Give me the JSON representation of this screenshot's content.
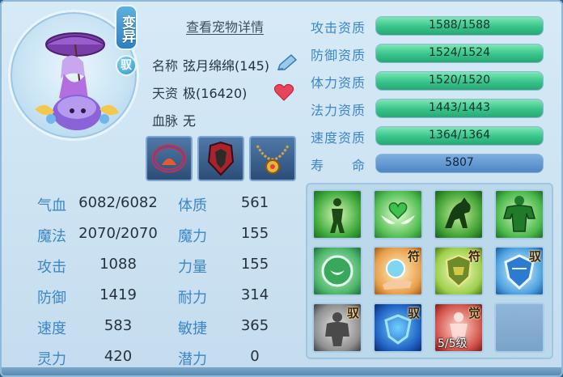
{
  "header": {
    "mutation_badge": "变异",
    "ride_badge": "驭",
    "detail_link": "查看宠物详情"
  },
  "pet": {
    "name_label": "名称",
    "name_value": "弦月绵绵(145)",
    "talent_label": "天资",
    "talent_value": "极(16420)",
    "bloodline_label": "血脉",
    "bloodline_value": "无"
  },
  "stats": [
    {
      "label": "气血",
      "value": "6082/6082"
    },
    {
      "label": "体质",
      "value": "561"
    },
    {
      "label": "魔法",
      "value": "2070/2070"
    },
    {
      "label": "魔力",
      "value": "155"
    },
    {
      "label": "攻击",
      "value": "1088"
    },
    {
      "label": "力量",
      "value": "155"
    },
    {
      "label": "防御",
      "value": "1419"
    },
    {
      "label": "耐力",
      "value": "314"
    },
    {
      "label": "速度",
      "value": "583"
    },
    {
      "label": "敏捷",
      "value": "365"
    },
    {
      "label": "灵力",
      "value": "420"
    },
    {
      "label": "潜力",
      "value": "0"
    }
  ],
  "aptitudes": [
    {
      "label": "攻击资质",
      "value": "1588/1588",
      "fill": 1.0
    },
    {
      "label": "防御资质",
      "value": "1524/1524",
      "fill": 1.0
    },
    {
      "label": "体力资质",
      "value": "1520/1520",
      "fill": 1.0
    },
    {
      "label": "法力资质",
      "value": "1443/1443",
      "fill": 1.0
    },
    {
      "label": "速度资质",
      "value": "1364/1364",
      "fill": 1.0
    }
  ],
  "lifespan": {
    "label": "寿　　命",
    "value": "5807"
  },
  "equipment": [
    "ring-equipment-icon",
    "armor-equipment-icon",
    "necklace-equipment-icon"
  ],
  "skills": [
    {
      "icon": "figure-aura-icon",
      "tag": "",
      "level": ""
    },
    {
      "icon": "winged-heart-icon",
      "tag": "",
      "level": ""
    },
    {
      "icon": "horse-icon",
      "tag": "",
      "level": ""
    },
    {
      "icon": "strong-man-icon",
      "tag": "",
      "level": ""
    },
    {
      "icon": "shield-emblem-icon",
      "tag": "",
      "level": ""
    },
    {
      "icon": "hand-orb-icon",
      "tag": "符",
      "level": ""
    },
    {
      "icon": "gold-shield-icon",
      "tag": "符",
      "level": ""
    },
    {
      "icon": "ice-shield-icon",
      "tag": "驭",
      "level": ""
    },
    {
      "icon": "stone-giant-icon",
      "tag": "驭",
      "level": ""
    },
    {
      "icon": "blue-shield-icon",
      "tag": "驭",
      "level": ""
    },
    {
      "icon": "awaken-figure-icon",
      "tag": "觉",
      "level": "5/5级"
    },
    {
      "icon": "empty-slot-icon",
      "tag": "",
      "level": ""
    }
  ],
  "colors": {
    "label_blue": "#3d86c6",
    "bar_green": "#37c48a",
    "panel_bg": "#d6eaf6"
  }
}
